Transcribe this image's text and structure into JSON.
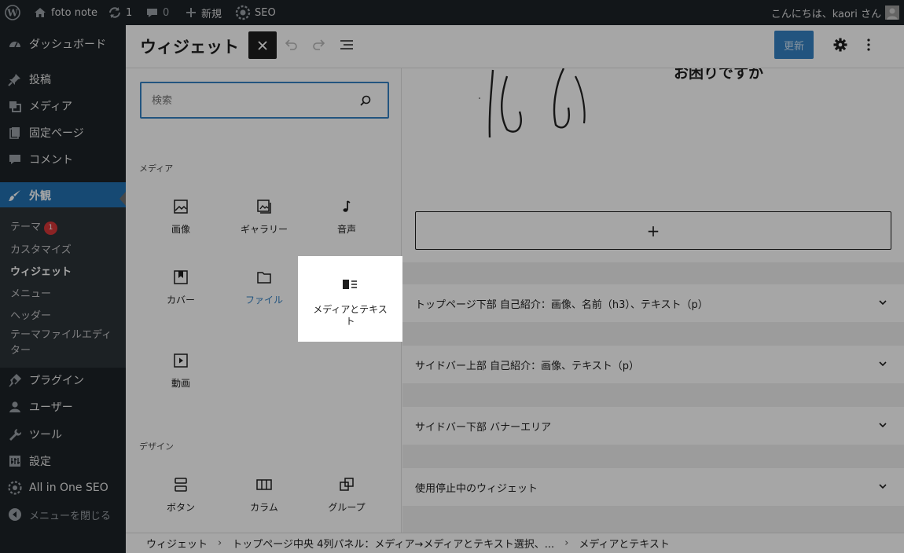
{
  "adminbar": {
    "site_name": "foto note",
    "updates_count": "1",
    "comments_count": "0",
    "new_label": "新規",
    "seo_label": "SEO",
    "greeting": "こんにちは、kaori さん"
  },
  "sidebar": {
    "items": [
      {
        "label": "ダッシュボード",
        "icon": "dashboard-icon"
      },
      {
        "label": "投稿",
        "icon": "pin-icon"
      },
      {
        "label": "メディア",
        "icon": "media-icon"
      },
      {
        "label": "固定ページ",
        "icon": "page-icon"
      },
      {
        "label": "コメント",
        "icon": "comment-icon"
      },
      {
        "label": "外観",
        "icon": "brush-icon"
      },
      {
        "label": "プラグイン",
        "icon": "plugin-icon"
      },
      {
        "label": "ユーザー",
        "icon": "user-icon"
      },
      {
        "label": "ツール",
        "icon": "wrench-icon"
      },
      {
        "label": "設定",
        "icon": "settings-icon"
      },
      {
        "label": "All in One SEO",
        "icon": "aioseo-icon"
      },
      {
        "label": "メニューを閉じる",
        "icon": "collapse-icon"
      }
    ],
    "submenu": [
      {
        "label": "テーマ",
        "badge": "1"
      },
      {
        "label": "カスタマイズ"
      },
      {
        "label": "ウィジェット"
      },
      {
        "label": "メニュー"
      },
      {
        "label": "ヘッダー"
      },
      {
        "label": "テーマファイルエディター"
      }
    ]
  },
  "header": {
    "title": "ウィジェット",
    "update_label": "更新"
  },
  "inserter": {
    "search_placeholder": "検索",
    "categories": {
      "media": "メディア",
      "design": "デザイン"
    },
    "media_blocks": [
      "画像",
      "ギャラリー",
      "音声",
      "カバー",
      "ファイル",
      "メディアとテキスト",
      "動画"
    ],
    "design_blocks": [
      "ボタン",
      "カラム",
      "グループ"
    ]
  },
  "canvas": {
    "heading_fragment": "お困りですか",
    "add_block_symbol": "+",
    "widget_areas": [
      "トップページ下部 自己紹介：画像、名前（h3）、テキスト（p）",
      "サイドバー上部 自己紹介：画像、テキスト（p）",
      "サイドバー下部 バナーエリア",
      "使用停止中のウィジェット"
    ]
  },
  "breadcrumb": [
    "ウィジェット",
    "トップページ中央 4列パネル：メディア→メディアとテキスト選択、...",
    "メディアとテキスト"
  ],
  "colors": {
    "admin_bg": "#1d2327",
    "accent": "#2271b1",
    "update_button": "#3582c4",
    "badge": "#d63638"
  }
}
